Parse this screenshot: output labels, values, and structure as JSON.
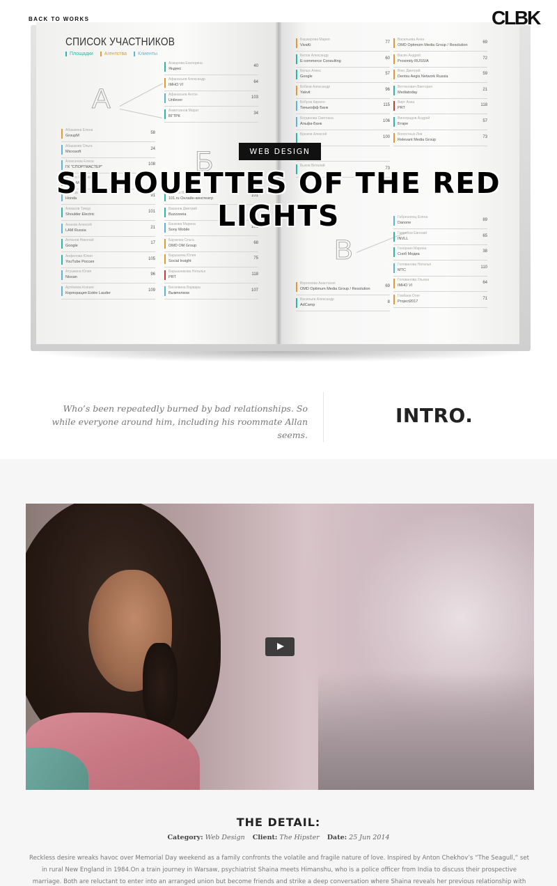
{
  "nav": {
    "back_label": "BACK TO WORKS",
    "logo": "CLBK"
  },
  "hero": {
    "category": "WEB DESIGN",
    "title": "SILHOUETTES OF THE RED LIGHTS",
    "book": {
      "title": "СПИСОК УЧАСТНИКОВ",
      "tabs": [
        {
          "label": "Площадки",
          "color": "#2bb7a5"
        },
        {
          "label": "Агентства",
          "color": "#e39a35"
        },
        {
          "label": "Клиенты",
          "color": "#5fb3d9"
        }
      ],
      "letters": [
        "A",
        "Б",
        "B"
      ],
      "columns": [
        [
          {
            "name": "Абашкина Елена",
            "company": "GroupM",
            "num": "58",
            "color": "#e39a35"
          },
          {
            "name": "Абашкова Ольга",
            "company": "Microsoft",
            "num": "24",
            "color": "#5fb3d9"
          },
          {
            "name": "Алексеева Елена",
            "company": "ГК \"СПОРТМАСТЕР\"",
            "num": "108",
            "color": "#5fb3d9"
          },
          {
            "name": "Алехин Евгений",
            "company": "GroupM",
            "num": "",
            "color": "#e39a35"
          },
          {
            "name": "Алимов Илья",
            "company": "Honda",
            "num": "91",
            "color": "#5fb3d9"
          },
          {
            "name": "Алмасов Тимур",
            "company": "Shoulder Electric",
            "num": "101",
            "color": "#2bb7a5"
          },
          {
            "name": "Ананов Алексей",
            "company": "LAM Russia",
            "num": "21",
            "color": "#5fb3d9"
          },
          {
            "name": "Антонов Николай",
            "company": "Google",
            "num": "17",
            "color": "#2bb7a5"
          },
          {
            "name": "Анфилова Юлия",
            "company": "YouTube Россия",
            "num": "105",
            "color": "#2bb7a5"
          },
          {
            "name": "Атушкина Юлия",
            "company": "Nissan",
            "num": "96",
            "color": "#5fb3d9"
          },
          {
            "name": "Артёмова Ксения",
            "company": "Корпорация Estée Lauder",
            "num": "109",
            "color": "#5fb3d9"
          }
        ],
        [
          {
            "name": "Асмарова Екатерина",
            "company": "Яндекс",
            "num": "40",
            "color": "#2bb7a5"
          },
          {
            "name": "Афанасьев Александр",
            "company": "IMHO VI",
            "num": "64",
            "color": "#e39a35"
          },
          {
            "name": "Афанасьев Антон",
            "company": "Unilever",
            "num": "103",
            "color": "#5fb3d9"
          },
          {
            "name": "Ахметзянов Марат",
            "company": "ВГТРК",
            "num": "34",
            "color": "#2bb7a5"
          },
          {
            "name": "Бабина Надежда",
            "company": "101.ru Онлайн-кинотеатр",
            "num": "101",
            "color": "#2bb7a5"
          },
          {
            "name": "Базанов Дмитрий",
            "company": "Buzzzeeia",
            "num": "",
            "color": "#2bb7a5"
          },
          {
            "name": "Банкова Марина",
            "company": "Sony Mobile",
            "num": "101",
            "color": "#5fb3d9"
          },
          {
            "name": "Барзкова Ольга",
            "company": "OMD OM Group",
            "num": "68",
            "color": "#e39a35"
          },
          {
            "name": "Барышева Юлия",
            "company": "Social Insight",
            "num": "75",
            "color": "#e39a35"
          },
          {
            "name": "Барышникова Наталья",
            "company": "PRT",
            "num": "118",
            "color": "#c73a3a"
          },
          {
            "name": "Бискевина Варвара",
            "company": "Вымпелком",
            "num": "107",
            "color": "#5fb3d9"
          }
        ],
        [
          {
            "name": "Башкирова Мария",
            "company": "VivaKi",
            "num": "77",
            "color": "#e39a35"
          },
          {
            "name": "Белов Александр",
            "company": "E-commerce Consulting",
            "num": "60",
            "color": "#2bb7a5"
          },
          {
            "name": "Белых Алекс",
            "company": "Google",
            "num": "57",
            "color": "#2bb7a5"
          },
          {
            "name": "Бобков Александр",
            "company": "Yakvit",
            "num": "96",
            "color": "#e39a35"
          },
          {
            "name": "Бобров Кирилл",
            "company": "Тинькофф Банк",
            "num": "115",
            "color": "#5fb3d9"
          },
          {
            "name": "Богданова Светлана",
            "company": "Альфа-Банк",
            "num": "106",
            "color": "#5fb3d9"
          },
          {
            "name": "Брюков Алексей",
            "company": "",
            "num": "100",
            "color": "#2bb7a5"
          },
          {
            "name": "",
            "company": "",
            "num": "",
            "color": "#2bb7a5"
          },
          {
            "name": "Быков Виталий",
            "company": "",
            "num": "73",
            "color": "#2bb7a5"
          },
          {
            "name": "Воронкова Анастасия",
            "company": "OMD Optimum Media Group / Resolution",
            "num": "69",
            "color": "#e39a35"
          },
          {
            "name": "Васильев Александр",
            "company": "AdCamp",
            "num": "8",
            "color": "#2bb7a5"
          }
        ],
        [
          {
            "name": "Васильева Анна",
            "company": "OMD Optimum Media Group / Resolution",
            "num": "69",
            "color": "#e39a35"
          },
          {
            "name": "Васин Андрей",
            "company": "Proximity RUSSIA",
            "num": "72",
            "color": "#e39a35"
          },
          {
            "name": "Вокс Дмитрий",
            "company": "Dentsu Aegis Network Russia",
            "num": "59",
            "color": "#e39a35"
          },
          {
            "name": "Веттенович Виктория",
            "company": "Mediatoday",
            "num": "21",
            "color": "#2bb7a5"
          },
          {
            "name": "Вирт Анна",
            "company": "PRT",
            "num": "118",
            "color": "#c73a3a"
          },
          {
            "name": "Виноградов Андрей",
            "company": "Бтаре",
            "num": "57",
            "color": "#2bb7a5"
          },
          {
            "name": "Волостных Лев",
            "company": "Relevant Media Group",
            "num": "73",
            "color": "#e39a35"
          },
          {
            "name": "Габриэлянц Елена",
            "company": "Danone",
            "num": "89",
            "color": "#5fb3d9"
          },
          {
            "name": "Гаврилов Евгений",
            "company": "INVLL",
            "num": "65",
            "color": "#2bb7a5"
          },
          {
            "name": "Генорнин Марина",
            "company": "Сноб Медиа",
            "num": "38",
            "color": "#2bb7a5"
          },
          {
            "name": "Голованова Наталья",
            "company": "МТС",
            "num": "110",
            "color": "#5fb3d9"
          },
          {
            "name": "Голованова Ульяна",
            "company": "IMHO VI",
            "num": "64",
            "color": "#e39a35"
          },
          {
            "name": "Гомбаев Олег",
            "company": "Project2017",
            "num": "71",
            "color": "#e39a35"
          }
        ]
      ]
    }
  },
  "intro": {
    "quote": "Who’s been repeatedly burned by bad relationships. So while everyone around him, including his roommate Allan seems.",
    "heading": "INTRO."
  },
  "video": {
    "play_icon": "play-icon"
  },
  "detail": {
    "heading": "THE DETAIL:",
    "category_label": "Category:",
    "category_value": "Web Design",
    "client_label": "Client:",
    "client_value": "The Hipster",
    "date_label": "Date:",
    "date_value": "25 Jun 2014",
    "body": "Reckless desire wreaks havoc over Memorial Day weekend as a family confronts the volatile and fragile nature of love. Inspired by Anton Chekhov’s “The Seagull,” set in rural New England in 1984.On a train journey in Warsaw, psychiatrist Shaina meets Himanshu, who is a police officer from India to discuss their prospective marriage. Both are reluctant to enter into an arranged union but become friends and strike a deep conversation where Shaina reveals her previous relationship with the eccentric Devi."
  }
}
